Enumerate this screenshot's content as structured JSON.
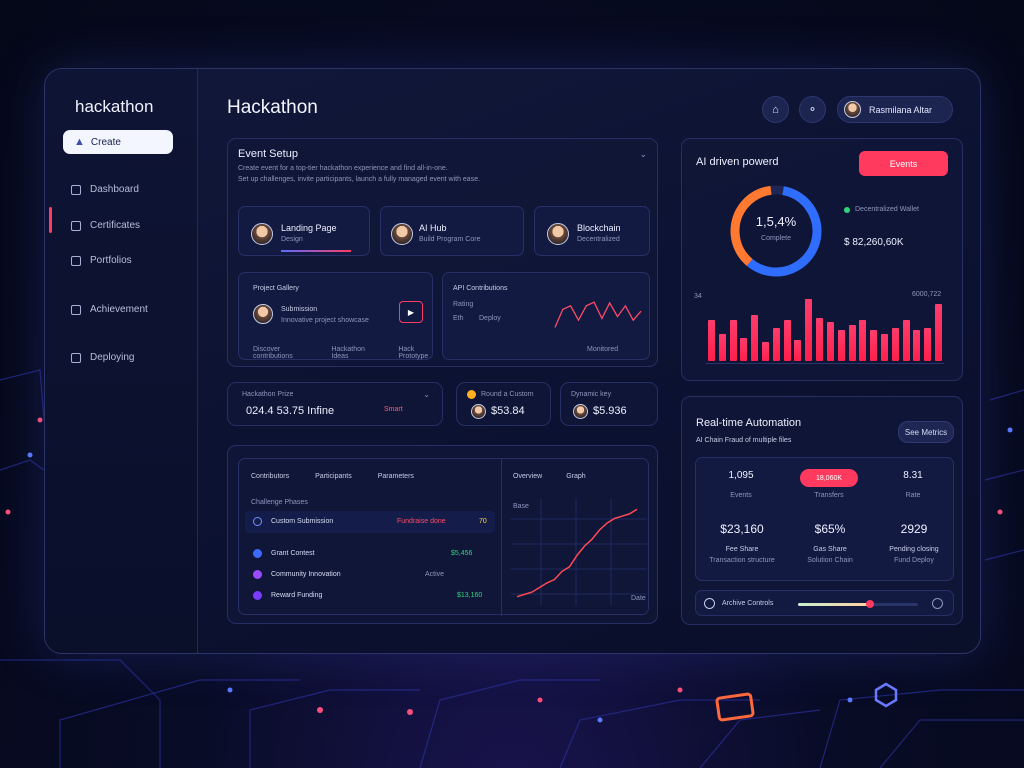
{
  "app": {
    "brand": "hackathon",
    "page_title": "Hackathon"
  },
  "sidebar": {
    "create_label": "Create",
    "items": [
      {
        "label": "Dashboard"
      },
      {
        "label": "Certificates"
      },
      {
        "label": "Portfolios"
      },
      {
        "label": "Achievement"
      },
      {
        "label": "Deploying"
      }
    ]
  },
  "header": {
    "user_name": "Rasmilana Altar"
  },
  "event_setup": {
    "title": "Event Setup",
    "desc_line1": "Create event for a top-tier hackathon experience and find all-in-one.",
    "desc_line2": "Set up challenges, invite participants, launch a fully managed event with ease.",
    "cards": [
      {
        "title": "Landing Page",
        "sub": "Design"
      },
      {
        "title": "AI Hub",
        "sub": "Build Program Core"
      },
      {
        "title": "Blockchain",
        "sub": "Decentralized"
      }
    ],
    "left_box": {
      "title": "Project Gallery",
      "row_name": "Submission",
      "row_sub": "Innovative project showcase",
      "tags": [
        "Discover contributions",
        "Hackathon Ideas",
        "Hack Prototype"
      ]
    },
    "right_box": {
      "title": "API Contributions",
      "label1": "Rating",
      "label2": "Eth",
      "value": "Deploy",
      "footer": "Monitored"
    }
  },
  "stats_row": {
    "budget": {
      "label": "Hackathon Prize",
      "value": "024.4 53.75 Infine",
      "tag": "Smart"
    },
    "card2": {
      "label": "Round a Custom",
      "value": "$53.84"
    },
    "card3": {
      "label": "Dynamic key",
      "value": "$5.936"
    }
  },
  "table_panel": {
    "headers": [
      "Contributors",
      "Participants",
      "Parameters"
    ],
    "subheader": "Challenge Phases",
    "rows": [
      {
        "name": "Custom Submission",
        "value": "Fundraise done",
        "extra": "70"
      },
      {
        "name": "Grant Contest",
        "value": "$5,456"
      },
      {
        "name": "Community Innovation",
        "value": "Active"
      },
      {
        "name": "Reward Funding",
        "value": "$13,160"
      }
    ],
    "chart_headers": [
      "Overview",
      "Graph"
    ],
    "chart_labels": [
      "Base",
      "Date"
    ]
  },
  "ai_panel": {
    "title": "AI driven powerd",
    "button": "Events",
    "donut_value": "1,5,4%",
    "donut_sub": "Complete",
    "legend_label": "Decentralized Wallet",
    "legend_value": "$ 82,260,60K",
    "chart_left": "34",
    "chart_right": "6000,722"
  },
  "realtime": {
    "title": "Real-time Automation",
    "subtitle": "AI Chain Fraud of multiple files",
    "button": "See Metrics",
    "stats_top": [
      {
        "value": "1,095",
        "label": "Events"
      },
      {
        "value": "18,060K",
        "label": "Transfers"
      },
      {
        "value": "8.31",
        "label": "Rate"
      }
    ],
    "stats_bottom": [
      {
        "value": "$23,160",
        "label": "Fee Share",
        "sub": "Transaction structure"
      },
      {
        "value": "$65%",
        "label": "Gas Share",
        "sub": "Solution Chain"
      },
      {
        "value": "2929",
        "label": "Pending closing",
        "sub": "Fund Deploy"
      }
    ],
    "slider_label": "Archive Controls",
    "slider_level": 0.6
  },
  "chart_data": [
    {
      "type": "bar",
      "values": [
        40,
        26,
        40,
        22,
        45,
        18,
        32,
        40,
        20,
        60,
        42,
        38,
        30,
        35,
        40,
        30,
        26,
        32,
        40,
        30,
        32,
        55
      ],
      "ylim": [
        0,
        60
      ],
      "color": "#ff2d5a"
    },
    {
      "type": "line",
      "values": [
        2,
        4,
        6,
        10,
        14,
        17,
        24,
        28,
        38,
        46,
        52,
        60,
        66,
        70,
        72,
        74,
        78
      ],
      "ylim": [
        0,
        80
      ],
      "color": "#ff4a55"
    },
    {
      "type": "line",
      "values": [
        10,
        60,
        70,
        30,
        70,
        80,
        35,
        78,
        40,
        70,
        30,
        55
      ],
      "ylim": [
        0,
        100
      ],
      "color": "#ff4a66"
    }
  ],
  "colors": {
    "accent": "#ff3a5e",
    "donut_orange": "#ff7a30",
    "donut_blue": "#2f6dff"
  }
}
